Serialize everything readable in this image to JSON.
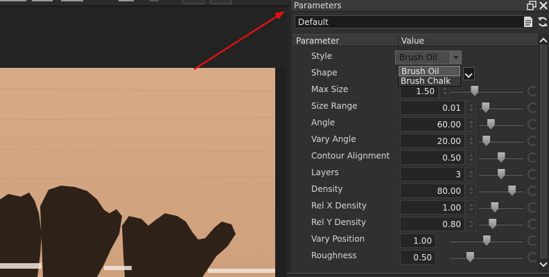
{
  "panel": {
    "title": "Parameters",
    "preset": "Default",
    "columns": {
      "parameter": "Parameter",
      "value": "Value"
    },
    "icons": [
      "float-window-icon",
      "close-icon",
      "preset-menu-icon",
      "refresh-icon"
    ]
  },
  "style_dropdown": {
    "selected": "Brush Oil",
    "options": [
      "Brush Oil",
      "Brush Chalk"
    ]
  },
  "rows": [
    {
      "label": "Style"
    },
    {
      "label": "Shape"
    },
    {
      "label": "Max Size",
      "value": "1.50",
      "slider": 0.32
    },
    {
      "label": "Size Range",
      "value": "0.01",
      "slider": 0.08
    },
    {
      "label": "Angle",
      "value": "60.00",
      "slider": 0.22
    },
    {
      "label": "Vary Angle",
      "value": "20.00",
      "slider": 0.1
    },
    {
      "label": "Contour Alignment",
      "value": "0.50",
      "slider": 0.5
    },
    {
      "label": "Layers",
      "value": "3",
      "slider": 0.5
    },
    {
      "label": "Density",
      "value": "80.00",
      "slider": 0.8
    },
    {
      "label": "Rel X Density",
      "value": "1.00",
      "slider": 0.33
    },
    {
      "label": "Rel Y Density",
      "value": "0.80",
      "slider": 0.27
    },
    {
      "label": "Vary Position",
      "value": "1.00",
      "slider": 0.5
    },
    {
      "label": "Roughness",
      "value": "0.50",
      "slider": 0.25
    }
  ],
  "colors": {
    "annotation_arrow": "#e01010",
    "canvas_paper": "#d9a985",
    "paint_dark": "#2e2218"
  }
}
